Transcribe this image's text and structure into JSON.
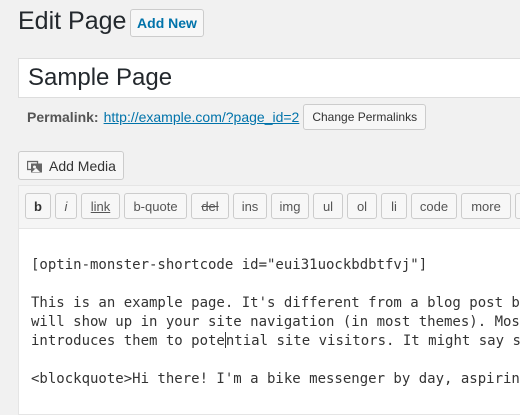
{
  "header": {
    "title": "Edit Page",
    "add_new_label": "Add New"
  },
  "post": {
    "title": "Sample Page",
    "permalink_label": "Permalink:",
    "permalink_url": "http://example.com/?page_id=2",
    "change_permalinks_label": "Change Permalinks"
  },
  "media": {
    "add_media_label": "Add Media",
    "icon": "media-icon"
  },
  "toolbar": {
    "buttons": [
      "b",
      "i",
      "link",
      "b-quote",
      "del",
      "ins",
      "img",
      "ul",
      "ol",
      "li",
      "code",
      "more"
    ]
  },
  "editor": {
    "shortcode": "[optin-monster-shortcode id=\"eui31uockbdbtfvj\"]",
    "line1": "This is an example page. It's different from a blog post beca",
    "line2": "will show up in your site navigation (in most themes). Most p",
    "line3_a": "introduces them to pote",
    "line3_b": "ntial site visitors. It might say som",
    "line4": "<blockquote>Hi there! I'm a bike messenger by day, aspiring a"
  }
}
